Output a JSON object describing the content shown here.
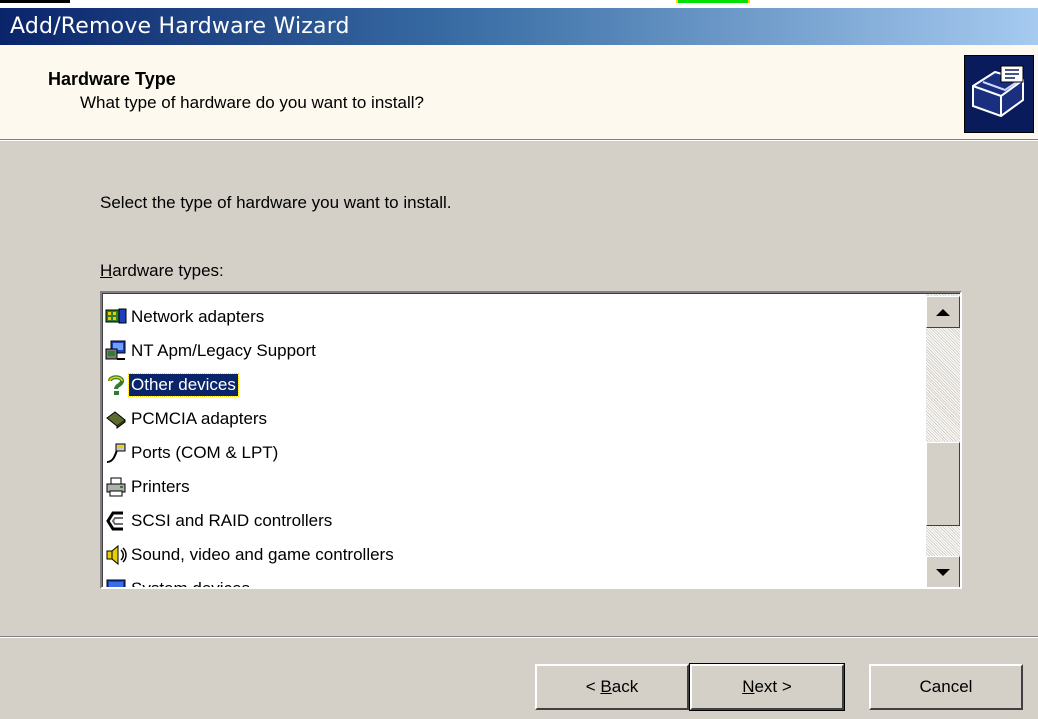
{
  "window": {
    "title": "Add/Remove Hardware Wizard"
  },
  "header": {
    "title": "Hardware Type",
    "subtitle": "What type of hardware do you want to install?",
    "icon": "hardware-wizard-icon"
  },
  "main": {
    "instruction": "Select the type of hardware you want to install.",
    "list_label_prefix": "H",
    "list_label_rest": "ardware types:",
    "items": [
      {
        "label": "Network adapters",
        "icon": "network-adapter-icon",
        "selected": false
      },
      {
        "label": "NT Apm/Legacy Support",
        "icon": "legacy-support-icon",
        "selected": false
      },
      {
        "label": "Other devices",
        "icon": "question-mark-icon",
        "selected": true
      },
      {
        "label": "PCMCIA adapters",
        "icon": "pcmcia-icon",
        "selected": false
      },
      {
        "label": "Ports (COM & LPT)",
        "icon": "port-icon",
        "selected": false
      },
      {
        "label": "Printers",
        "icon": "printer-icon",
        "selected": false
      },
      {
        "label": "SCSI and RAID controllers",
        "icon": "scsi-icon",
        "selected": false
      },
      {
        "label": "Sound, video and game controllers",
        "icon": "speaker-icon",
        "selected": false
      },
      {
        "label": "System devices",
        "icon": "system-device-icon",
        "selected": false
      }
    ]
  },
  "buttons": {
    "back_prefix": "< ",
    "back_key": "B",
    "back_rest": "ack",
    "next_key": "N",
    "next_rest": "ext >",
    "cancel": "Cancel"
  },
  "colors": {
    "titlebar_start": "#0a246a",
    "titlebar_end": "#a6caf0",
    "dialog_bg": "#d4d0c8",
    "header_bg": "#fdf9ef",
    "selection": "#0a246a"
  }
}
